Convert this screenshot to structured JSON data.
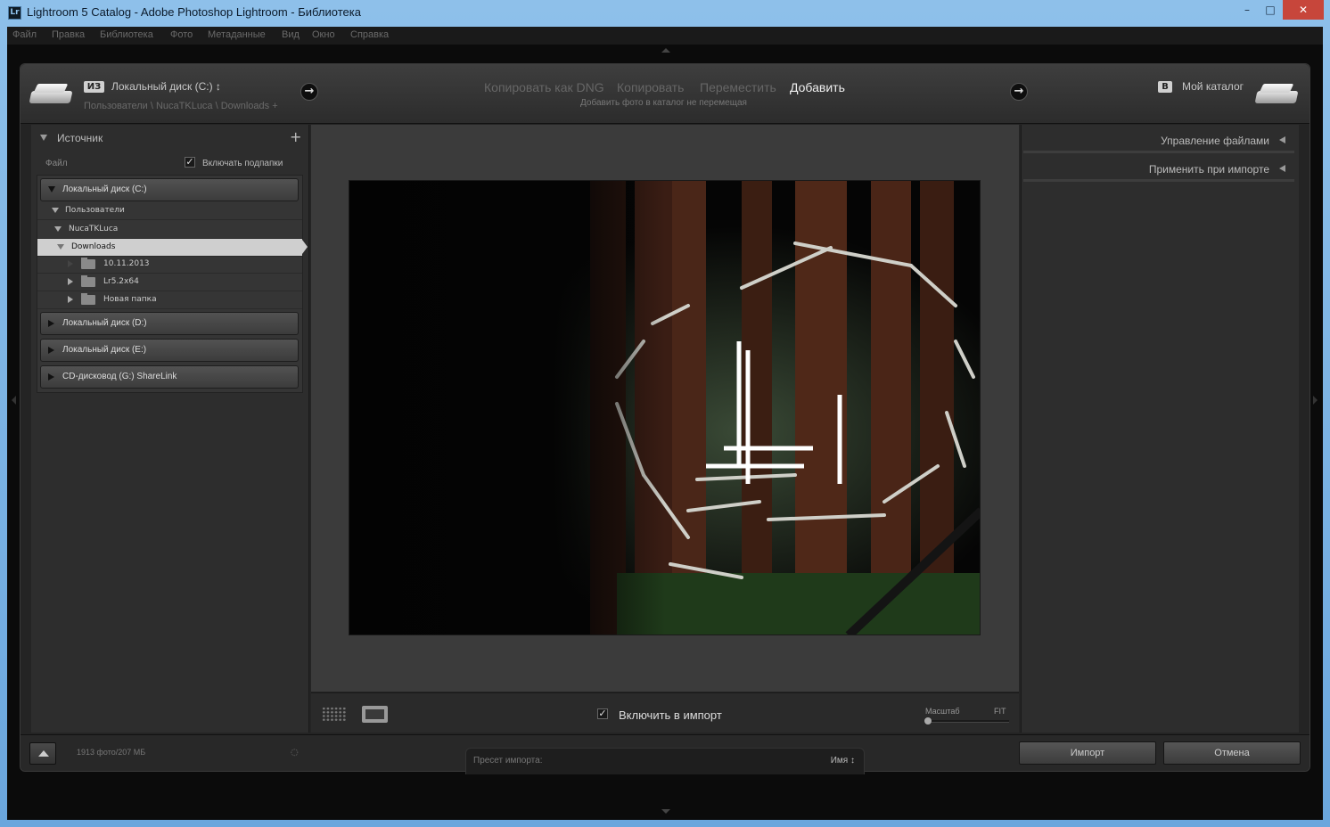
{
  "window": {
    "icon_text": "Lr",
    "title": "Lightroom 5 Catalog - Adobe Photoshop Lightroom - Библиотека",
    "min_glyph": "–",
    "max_glyph": "□",
    "close_glyph": "✕"
  },
  "menu": [
    "Файл",
    "Правка",
    "Библиотека",
    "Фото",
    "Метаданные",
    "Вид",
    "Окно",
    "Справка"
  ],
  "header": {
    "from_tag": "ИЗ",
    "source_name": "Локальный диск (C:) ↕",
    "source_path": "Пользователи \\ NucaTKLuca \\ Downloads +",
    "modes": [
      "Копировать как DNG",
      "Копировать",
      "Переместить",
      "Добавить"
    ],
    "active_mode": "Добавить",
    "mode_description": "Добавить фото в каталог не перемещая",
    "to_tag": "В",
    "destination_name": "Мой каталог",
    "arrow_glyph": "→"
  },
  "source_panel": {
    "title": "Источник",
    "plus_glyph": "+",
    "file_label": "Файл",
    "include_subfolders_label": "Включать подпапки",
    "include_subfolders_checked": true,
    "volumes": [
      {
        "label": "Локальный диск (C:)",
        "expanded": true
      },
      {
        "label": "Локальный диск (D:)",
        "expanded": false
      },
      {
        "label": "Локальный диск (E:)",
        "expanded": false
      },
      {
        "label": "CD-дисковод (G:) ShareLink",
        "expanded": false
      }
    ],
    "tree": {
      "users": "Пользователи",
      "user": "NucaTKLuca",
      "selected": "Downloads",
      "folders": [
        "10.11.2013",
        "Lr5.2x64",
        "Новая папка"
      ]
    }
  },
  "center": {
    "include_label": "Включить в импорт",
    "include_checked": true,
    "zoom_label": "Масштаб",
    "fit_label": "FIT",
    "zoom_level": 0.0
  },
  "right_panel": {
    "sections": [
      "Управление файлами",
      "Применить при импорте"
    ]
  },
  "footer": {
    "photo_count": "1913 фото/207 МБ",
    "spinner_glyph": "◌",
    "preset_label": "Пресет импорта:",
    "preset_value": "Имя ↕",
    "import_label": "Импорт",
    "cancel_label": "Отмена"
  },
  "colors": {
    "panel_bg": "#2d2d2d",
    "center_bg": "#3b3b3b",
    "selection": "#cfcfcf",
    "close_button": "#c7463b"
  }
}
